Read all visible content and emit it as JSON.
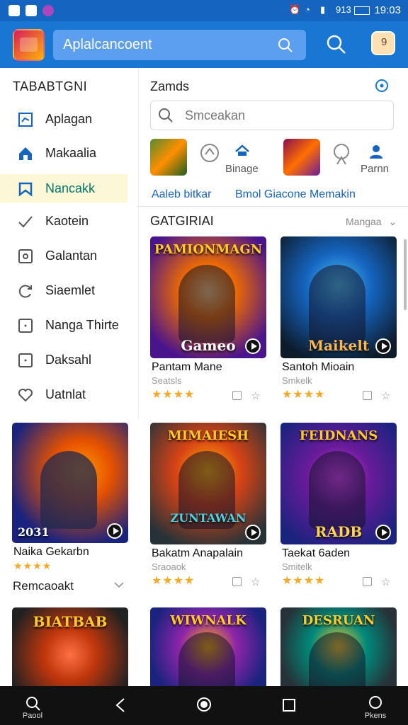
{
  "status_bar": {
    "time": "19:03",
    "battery": "913"
  },
  "header": {
    "search_value": "Aplalcancoent"
  },
  "sidebar": {
    "title": "TABABTGNI",
    "items": [
      {
        "label": "Aplagan",
        "icon": "app-box-icon"
      },
      {
        "label": "Makaalia",
        "icon": "home-icon"
      },
      {
        "label": "Nancakk",
        "icon": "bookmark-icon"
      },
      {
        "label": "Kaotein",
        "icon": "check-icon"
      },
      {
        "label": "Galantan",
        "icon": "clock-icon"
      },
      {
        "label": "Siaemlet",
        "icon": "refresh-icon"
      },
      {
        "label": "Nanga Thirte",
        "icon": "square-icon"
      },
      {
        "label": "Daksahl",
        "icon": "square-icon"
      },
      {
        "label": "Uatnlat",
        "icon": "broken-heart-icon"
      }
    ],
    "featured": {
      "caption": "2031",
      "title": "Naika Gekarbn",
      "stars": "★★★★"
    },
    "recommended_heading": "Remcaoakt",
    "bottom_card_caption": "BIATBAB"
  },
  "content": {
    "title": "Zamds",
    "search_placeholder": "Smceakan",
    "quick": [
      {
        "label": "Binage"
      },
      {
        "label": "Parnn"
      }
    ],
    "tabs": [
      "Aaleb bitkar",
      "Bmol Giacone Memakin"
    ],
    "category_title": "GATGIRIAI",
    "sort_label": "Mangaa",
    "cards": [
      {
        "top": "PAMIONMAGN",
        "cap": "Gameo",
        "title": "Pantam Mane",
        "sub": "Seatsls",
        "stars": "★★★★"
      },
      {
        "top": "",
        "cap": "Maikelt",
        "title": "Santoh Mioain",
        "sub": "Smkelk",
        "stars": "★★★★"
      },
      {
        "top": "MIMAIESH",
        "cap": "ZUNTAWAN",
        "title": "Bakatm Anapalain",
        "sub": "Sraoaok",
        "stars": "★★★★"
      },
      {
        "top": "FEIDNANS",
        "cap": "RADB",
        "title": "Taekat 6aden",
        "sub": "Smitelk",
        "stars": "★★★★"
      },
      {
        "top": "WIWNALK",
        "cap": "",
        "title": "",
        "sub": "",
        "stars": ""
      },
      {
        "top": "DESRUAN",
        "cap": "",
        "title": "",
        "sub": "",
        "stars": ""
      }
    ]
  },
  "bottom_nav": [
    {
      "label": "Paool",
      "icon": "search-icon"
    },
    {
      "label": "",
      "icon": "back-icon"
    },
    {
      "label": "",
      "icon": "home-circle-icon"
    },
    {
      "label": "",
      "icon": "recents-icon"
    },
    {
      "label": "Pkens",
      "icon": "circle-icon"
    }
  ],
  "colors": {
    "primary": "#1976d2",
    "active_item_bg": "#fcf7d6",
    "star": "#f9a825"
  }
}
